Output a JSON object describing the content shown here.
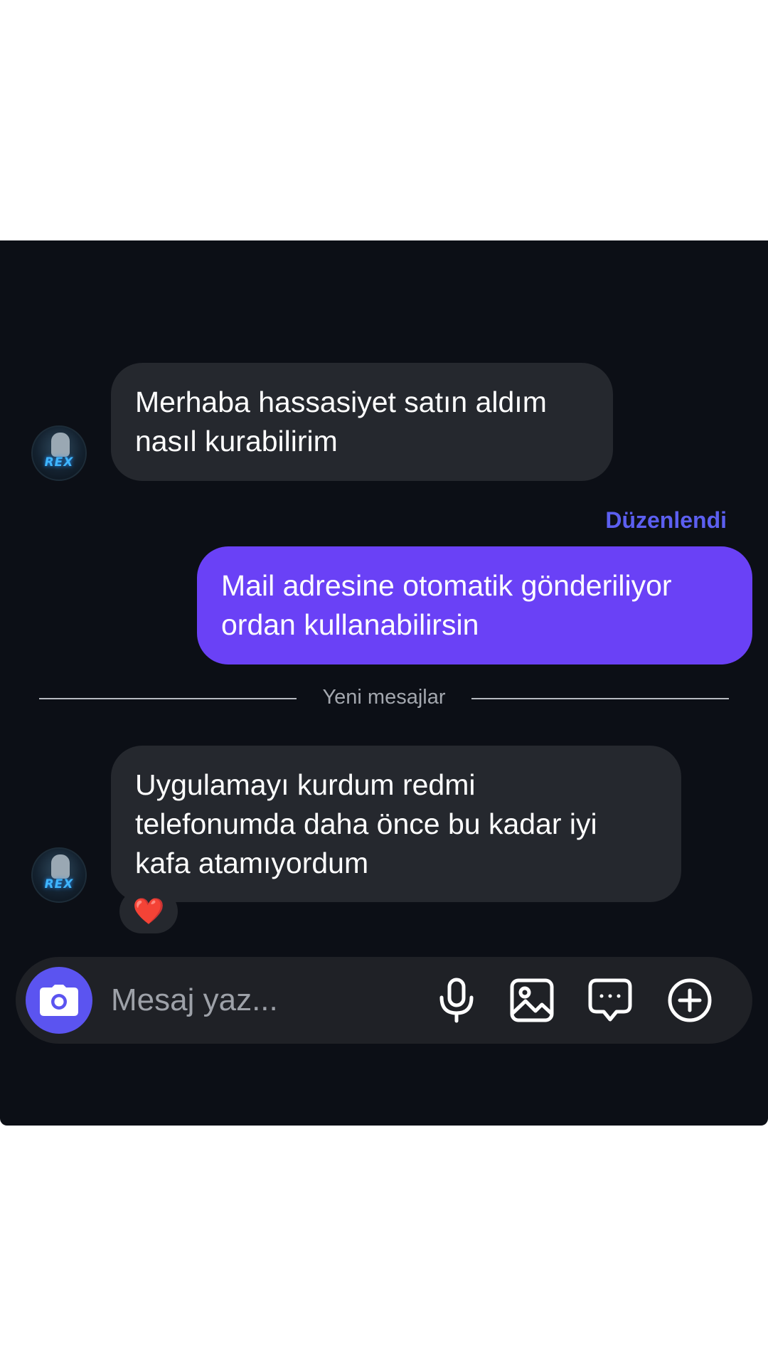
{
  "messages": [
    {
      "direction": "incoming",
      "text_line1": "Merhaba hassasiyet satın aldım",
      "text_line2": "nasıl kurabilirim",
      "avatar_logo": "REX"
    },
    {
      "direction": "outgoing",
      "edited_label": "Düzenlendi",
      "text_line1": "Mail adresine otomatik gönderiliyor",
      "text_line2": "ordan kullanabilirsin"
    },
    {
      "direction": "incoming",
      "text_line1": "Uygulamayı kurdum redmi",
      "text_line2": "telefonumda  daha önce bu kadar iyi",
      "text_line3": "kafa atamıyordum",
      "reaction": "❤️",
      "avatar_logo": "REX"
    }
  ],
  "divider": {
    "label": "Yeni mesajlar"
  },
  "composer": {
    "placeholder": "Mesaj yaz...",
    "icons": [
      "camera-icon",
      "microphone-icon",
      "image-icon",
      "chat-bubble-icon",
      "plus-circle-icon"
    ]
  },
  "colors": {
    "background": "#0c0f16",
    "incoming_bubble": "#25282e",
    "outgoing_bubble": "#6a41f6",
    "accent": "#5b54f0",
    "edited_label": "#5c5ff0"
  }
}
